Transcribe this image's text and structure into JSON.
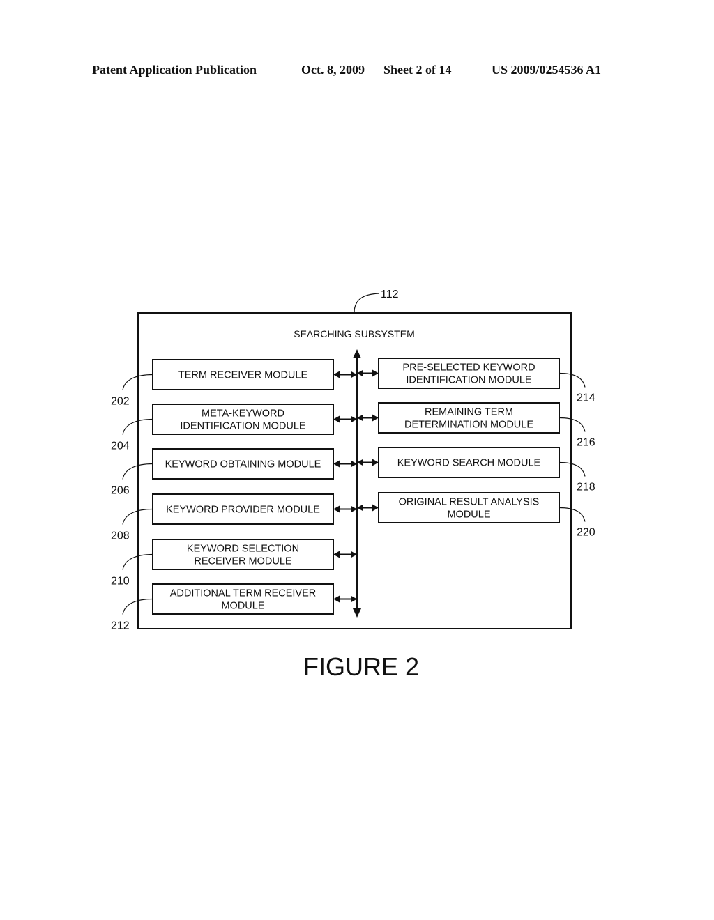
{
  "header": {
    "publication": "Patent Application Publication",
    "date": "Oct. 8, 2009",
    "sheet": "Sheet 2 of 14",
    "number": "US 2009/0254536 A1"
  },
  "diagram": {
    "container": {
      "ref": "112",
      "title": "SEARCHING SUBSYSTEM"
    },
    "left_modules": [
      {
        "ref": "202",
        "lines": [
          "TERM RECEIVER MODULE"
        ]
      },
      {
        "ref": "204",
        "lines": [
          "META-KEYWORD",
          "IDENTIFICATION MODULE"
        ]
      },
      {
        "ref": "206",
        "lines": [
          "KEYWORD OBTAINING MODULE"
        ]
      },
      {
        "ref": "208",
        "lines": [
          "KEYWORD PROVIDER MODULE"
        ]
      },
      {
        "ref": "210",
        "lines": [
          "KEYWORD SELECTION",
          "RECEIVER MODULE"
        ]
      },
      {
        "ref": "212",
        "lines": [
          "ADDITIONAL TERM RECEIVER",
          "MODULE"
        ]
      }
    ],
    "right_modules": [
      {
        "ref": "214",
        "lines": [
          "PRE-SELECTED KEYWORD",
          "IDENTIFICATION MODULE"
        ]
      },
      {
        "ref": "216",
        "lines": [
          "REMAINING TERM",
          "DETERMINATION MODULE"
        ]
      },
      {
        "ref": "218",
        "lines": [
          "KEYWORD SEARCH MODULE"
        ]
      },
      {
        "ref": "220",
        "lines": [
          "ORIGINAL RESULT ANALYSIS",
          "MODULE"
        ]
      }
    ],
    "caption": "FIGURE 2"
  }
}
